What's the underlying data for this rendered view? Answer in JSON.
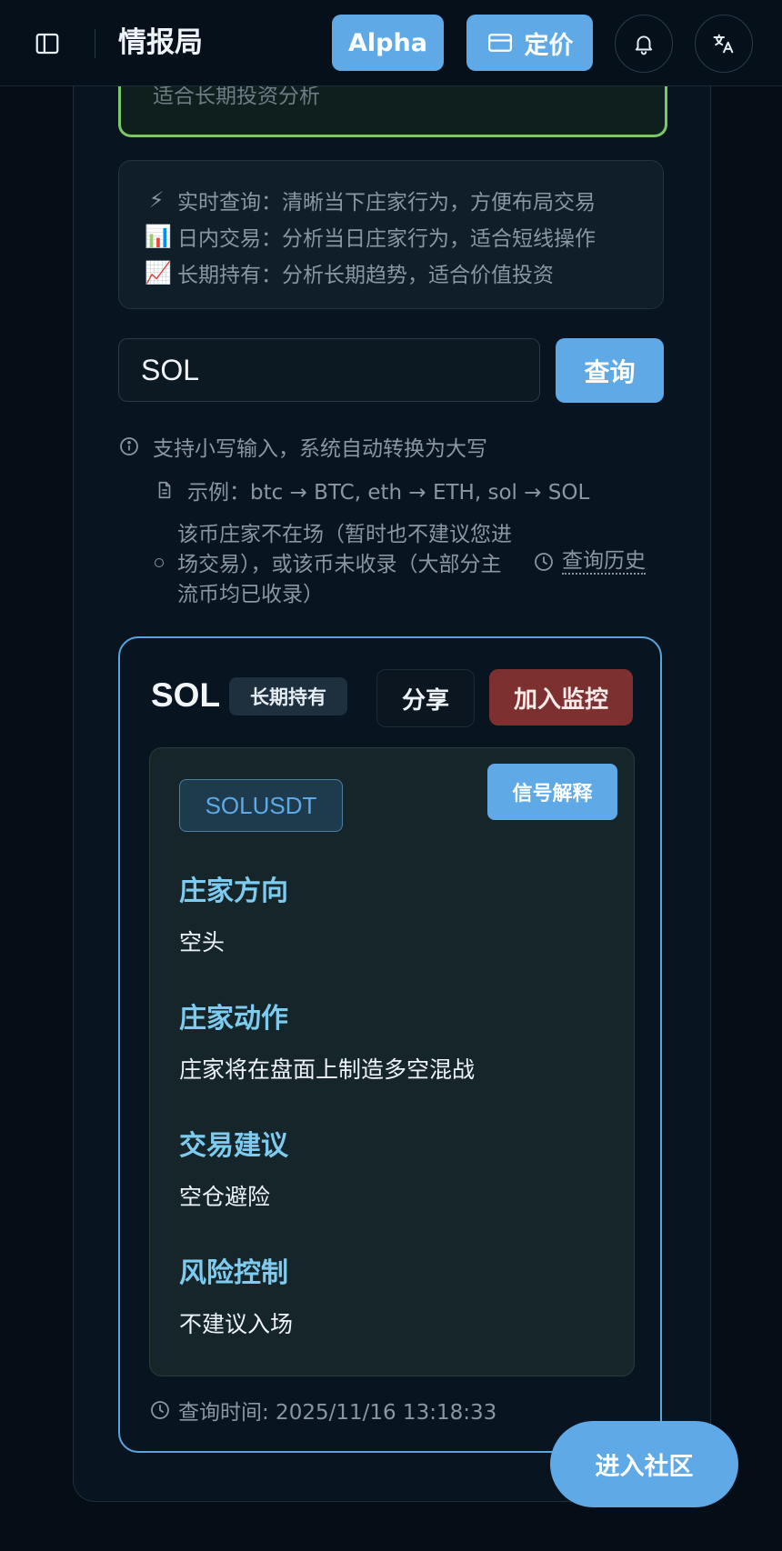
{
  "header": {
    "brand": "情报局",
    "alpha_label": "Alpha",
    "pricing_label": "定价"
  },
  "top_notice": {
    "text": "适合长期投资分析"
  },
  "modes": [
    {
      "icon": "⚡",
      "text": "实时查询：清晰当下庄家行为，方便布局交易"
    },
    {
      "icon": "📊",
      "text": "日内交易：分析当日庄家行为，适合短线操作"
    },
    {
      "icon": "📈",
      "text": "长期持有：分析长期趋势，适合价值投资"
    }
  ],
  "search": {
    "value": "SOL",
    "button_label": "查询"
  },
  "hints": {
    "lowercase": "支持小写输入，系统自动转换为大写",
    "example": "示例：btc → BTC, eth → ETH, sol → SOL",
    "not_listed": "该币庄家不在场（暂时也不建议您进场交易），或该币未收录（大部分主流币均已收录）",
    "history_link": "查询历史"
  },
  "result": {
    "symbol": "SOL",
    "term_badge": "长期持有",
    "share_label": "分享",
    "monitor_label": "加入监控",
    "pair": "SOLUSDT",
    "explain_label": "信号解释",
    "signals": [
      {
        "label": "庄家方向",
        "value": "空头"
      },
      {
        "label": "庄家动作",
        "value": "庄家将在盘面上制造多空混战"
      },
      {
        "label": "交易建议",
        "value": "空仓避险"
      },
      {
        "label": "风险控制",
        "value": "不建议入场"
      }
    ],
    "query_time": "查询时间: 2025/11/16 13:18:33"
  },
  "community_label": "进入社区",
  "colors": {
    "accent": "#5ea9e6",
    "danger": "#7c3030",
    "highlight_border": "#7bc86c",
    "signal_label": "#7ecbf0",
    "background": "#050d16"
  }
}
